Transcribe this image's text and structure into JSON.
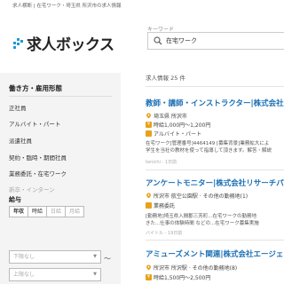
{
  "breadcrumb": "求人横断 | 在宅ワーク・埼玉県 所沢市の求人情報",
  "logo_text": "求人ボックス",
  "search": {
    "label": "キーワード",
    "value": "在宅ワーク"
  },
  "sidebar": {
    "employment_title": "働き方・雇用形態",
    "employment_items": [
      {
        "label": "正社員",
        "enabled": true
      },
      {
        "label": "アルバイト・パート",
        "enabled": true
      },
      {
        "label": "派遣社員",
        "enabled": true
      },
      {
        "label": "契約・臨時・期間社員",
        "enabled": true
      },
      {
        "label": "業務委託・在宅ワーク",
        "enabled": true
      },
      {
        "label": "新卒・インターン",
        "enabled": false
      }
    ],
    "salary_title": "給与",
    "salary_tabs": [
      "年収",
      "時給",
      "日給",
      "月給"
    ],
    "salary_min_placeholder": "下限なし",
    "salary_max_placeholder": "上限なし",
    "tilde": "〜"
  },
  "results": {
    "count": "求人情報 25 件",
    "jobs": [
      {
        "title": "教師・講師・インストラクター|株式会社デ",
        "location": "埼玉県 所沢市",
        "salary": "時給1,000円〜1,200円",
        "type": "アルバイト・パート",
        "desc1": "在宅ワーク[管理番号]4464149 [募集背景]業務拡大によ",
        "desc2": "学生を当社の教材を使って指導して頂きます。解答・解説",
        "source": "tenichi - 1日前"
      },
      {
        "title": "アンケートモニター|株式会社リサーチパネ",
        "location": "所沢市 航空公園駅 · その他の勤務地(1)",
        "salary": "",
        "type": "業務委託",
        "desc1": "[勤務地]埼玉県入間郡三芳町...在宅ワークの勤務地",
        "desc2": "きた...仕事の体験時間 などの...在宅ワーク募集実施",
        "source": "バイトル - 19日前"
      },
      {
        "title": "アミューズメント関連|株式会社エージェン",
        "location": "所沢市 所沢駅 · その他の勤務地(8)",
        "salary": "時給1,500円〜2,500円",
        "type": "",
        "desc1": "",
        "desc2": "",
        "source": ""
      }
    ]
  },
  "colors": {
    "accent": "#1e9ad6",
    "link": "#1a6fb5",
    "orange": "#e7a21b",
    "sidebar_bg": "#f4f4f4"
  }
}
